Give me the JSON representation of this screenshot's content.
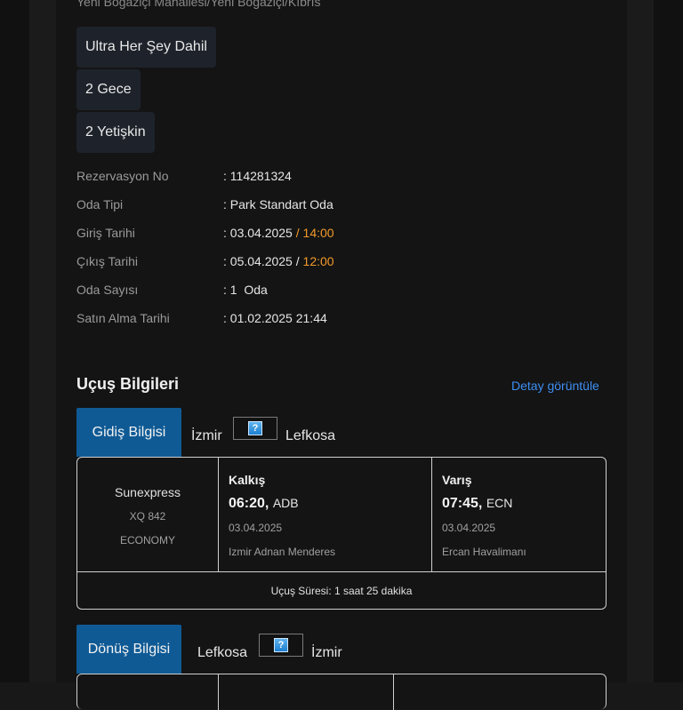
{
  "hotel": {
    "address": "Yeni Boğaziçi Mahallesi/Yeni Boğaziçi/Kıbrıs",
    "chips": [
      "Ultra Her Şey Dahil",
      "2 Gece",
      "2 Yetişkin"
    ]
  },
  "reservation": {
    "rows": [
      {
        "label": "Rezervasyon No",
        "value": ": 114281324"
      },
      {
        "label": "Oda Tipi",
        "value": ": Park Standart Oda"
      },
      {
        "label": "Giriş Tarihi",
        "value": ": 03.04.2025",
        "sep": " / ",
        "time": "14:00"
      },
      {
        "label": "Çıkış Tarihi",
        "value": ": 05.04.2025",
        "sep": " / ",
        "time": "12:00"
      },
      {
        "label": "Oda Sayısı",
        "value": ": 1  Oda"
      },
      {
        "label": "Satın Alma Tarihi",
        "value": ": 01.02.2025 21:44"
      }
    ]
  },
  "flight": {
    "title": "Uçuş Bilgileri",
    "detail_link": "Detay görüntüle",
    "outbound": {
      "tab": "Gidiş Bilgisi",
      "from": "İzmir",
      "to": "Lefkosa",
      "airline": "Sunexpress",
      "flight_no": "XQ 842",
      "cabin": "ECONOMY",
      "departure": {
        "title": "Kalkış",
        "time": "06:20,",
        "code": "ADB",
        "date": "03.04.2025",
        "airport": "Izmir Adnan Menderes"
      },
      "arrival": {
        "title": "Varış",
        "time": "07:45,",
        "code": "ECN",
        "date": "03.04.2025",
        "airport": "Ercan Havalimanı"
      },
      "duration": "Uçuş Süresi: 1 saat 25 dakika"
    },
    "return": {
      "tab": "Dönüş Bilgisi",
      "from": "Lefkosa",
      "to": "İzmir"
    },
    "icon_glyph": "?"
  },
  "colors": {
    "accent_blue": "#0f5a95",
    "link_blue": "#3d8ef2",
    "time_orange": "#f39a2a"
  }
}
